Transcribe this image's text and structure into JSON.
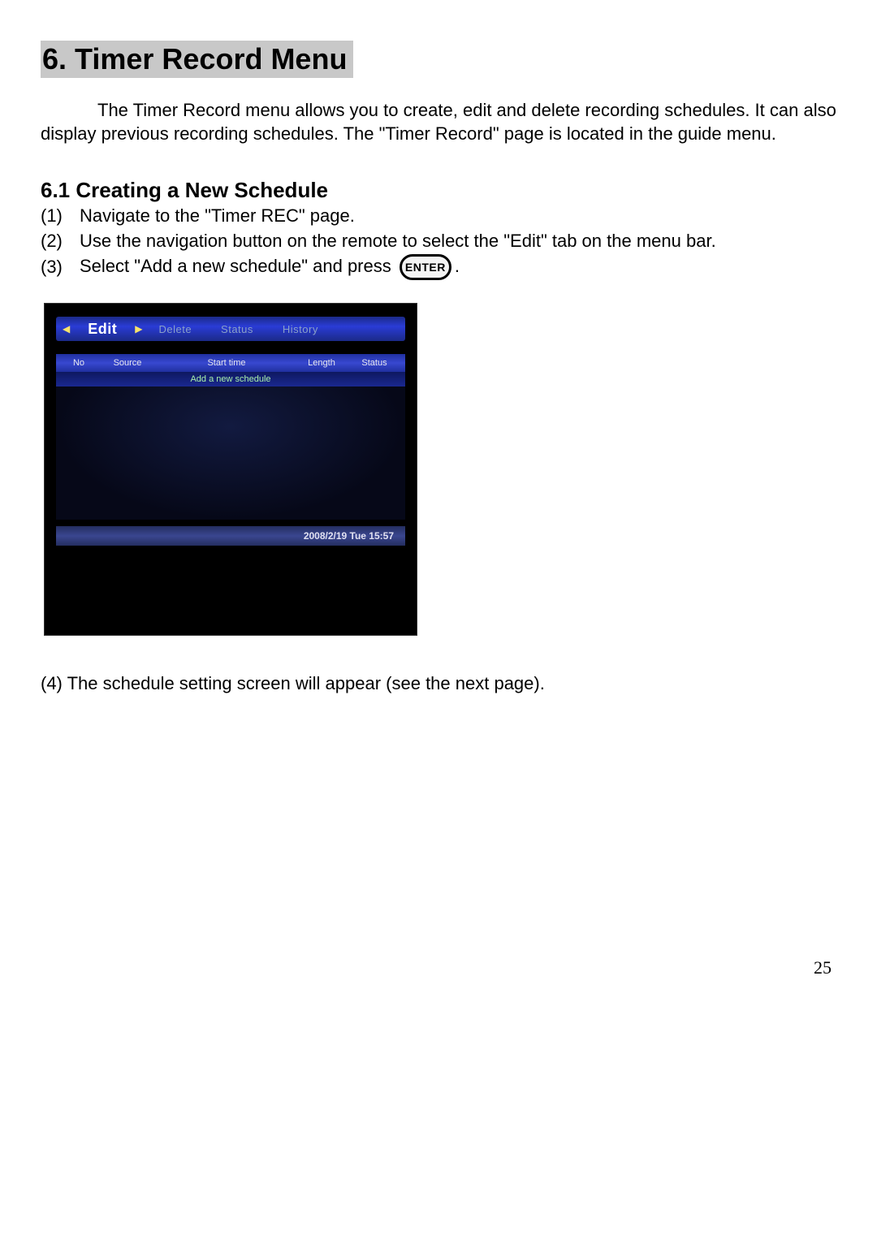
{
  "heading": "6. Timer Record Menu",
  "intro": "The Timer Record menu allows you to create, edit and delete recording schedules. It can also display previous recording schedules. The \"Timer Record\" page is located in the guide menu.",
  "sub_heading": "6.1 Creating a New Schedule",
  "steps": {
    "s1_num": "(1)",
    "s1": "Navigate to the \"Timer REC\" page.",
    "s2_num": "(2)",
    "s2": "Use the navigation button on the remote to select the \"Edit\" tab on the menu bar.",
    "s3_num": "(3)",
    "s3_before": "Select \"Add a new schedule\" and press",
    "s3_btn": "ENTER",
    "s3_after": "."
  },
  "tv": {
    "tab_edit": "Edit",
    "tab_delete": "Delete",
    "tab_status": "Status",
    "tab_history": "History",
    "col_no": "No",
    "col_source": "Source",
    "col_start": "Start time",
    "col_length": "Length",
    "col_status": "Status",
    "add_new": "Add a new schedule",
    "timestamp": "2008/2/19 Tue 15:57"
  },
  "after": "(4) The schedule setting screen will appear (see the next page).",
  "page_number": "25"
}
